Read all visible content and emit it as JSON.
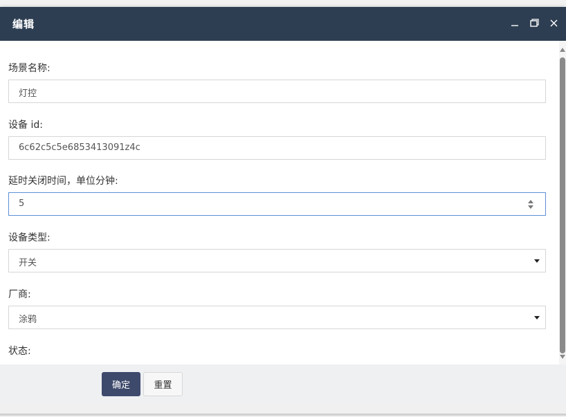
{
  "dialog": {
    "title": "编辑"
  },
  "form": {
    "scene_name": {
      "label": "场景名称:",
      "value": "灯控"
    },
    "device_id": {
      "label": "设备 id:",
      "value": "6c62c5c5e6853413091z4c"
    },
    "delay_close": {
      "label": "延时关闭时间，单位分钟:",
      "value": "5"
    },
    "device_type": {
      "label": "设备类型:",
      "value": "开关"
    },
    "vendor": {
      "label": "厂商:",
      "value": "涂鸦"
    },
    "status": {
      "label": "状态:"
    }
  },
  "footer": {
    "confirm_label": "确定",
    "reset_label": "重置"
  },
  "colors": {
    "titlebar": "#2e3e52",
    "confirm_button": "#3e4a6c",
    "focus_border": "#5b8fd6",
    "footer_bg": "#eef0f2"
  },
  "icons": {
    "minimize": "minimize-icon",
    "maximize": "maximize-icon",
    "close": "close-icon",
    "spinner": "spinner-arrows-icon",
    "dropdown": "chevron-down-icon"
  }
}
